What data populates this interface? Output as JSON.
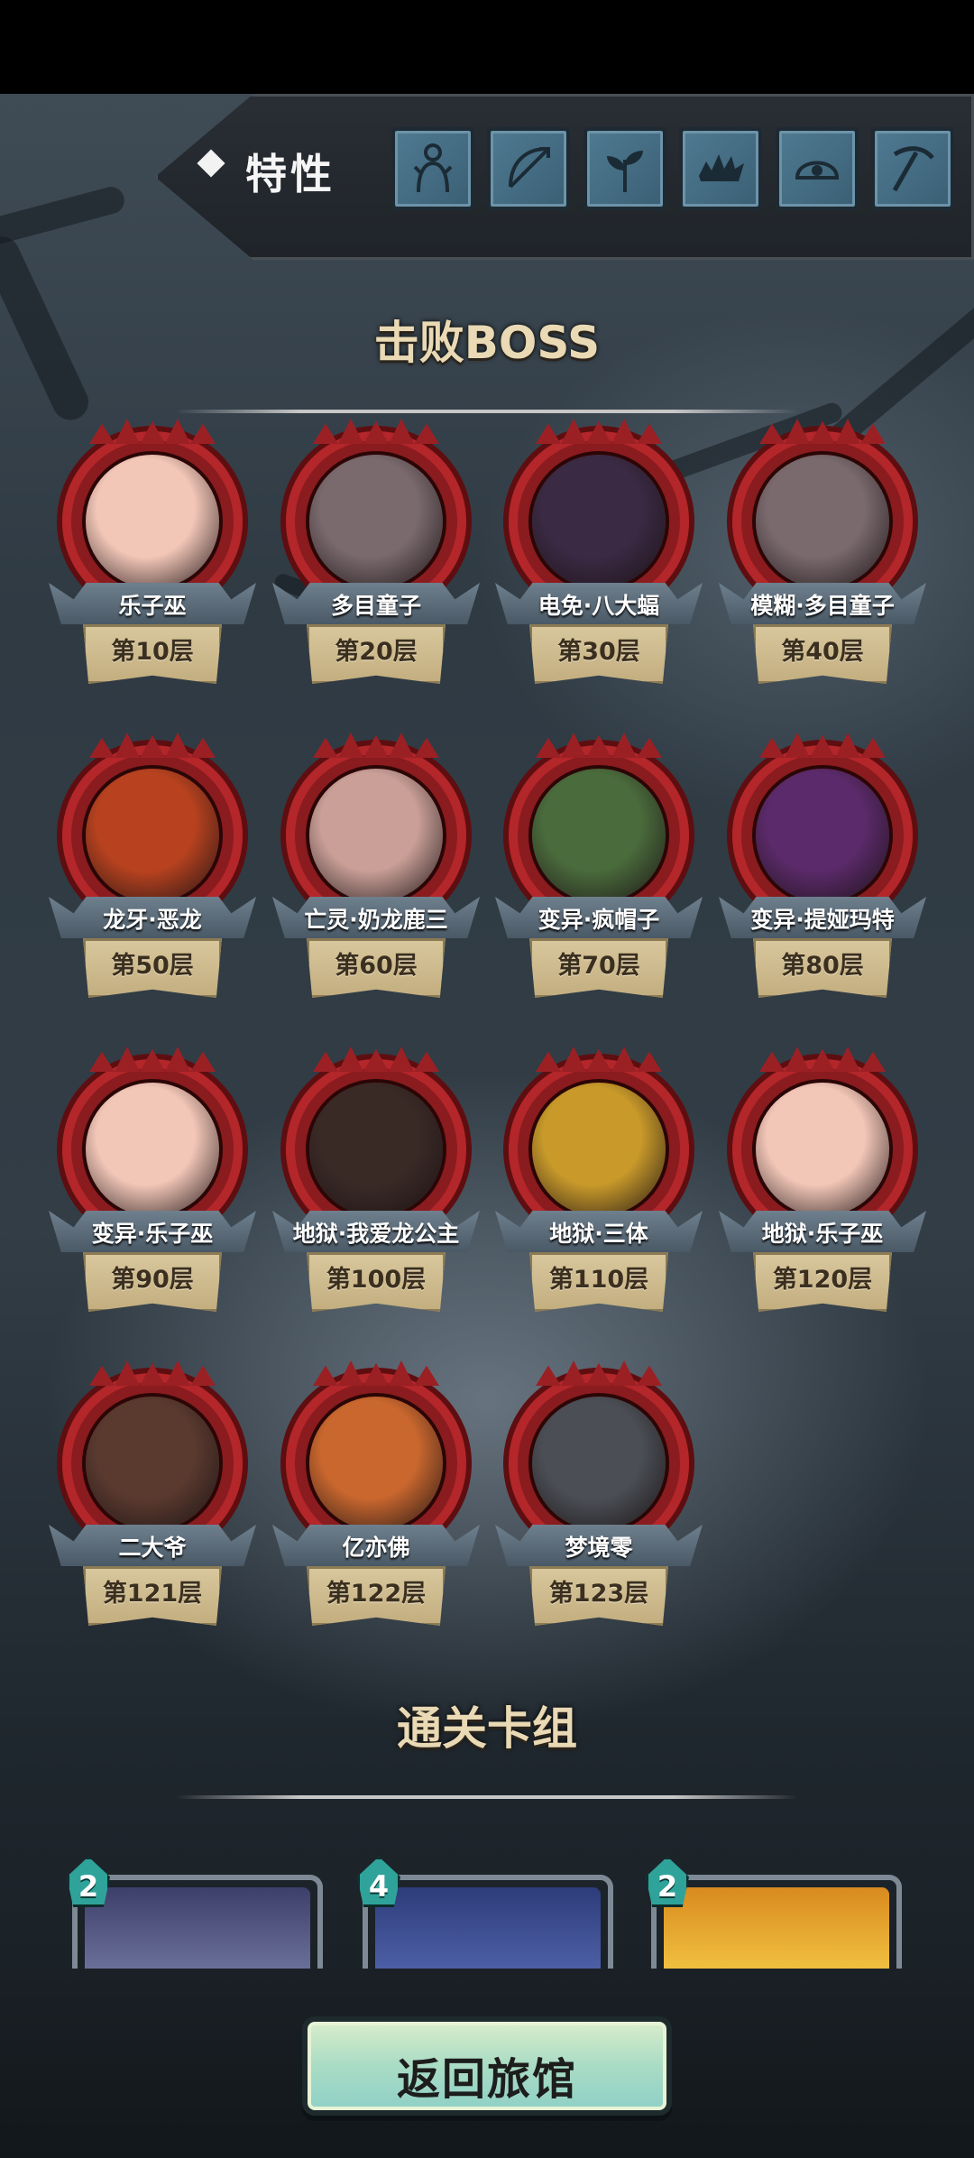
{
  "traits": {
    "label": "特性",
    "icons": [
      "strongman-icon",
      "bow-arrow-icon",
      "plant-icon",
      "spiky-creature-icon",
      "cloud-eye-icon",
      "pickaxe-icon"
    ]
  },
  "bosses_section": {
    "title": "击败BOSS",
    "items": [
      {
        "name": "乐子巫",
        "floor": "第10层",
        "color": "#f3c7b8"
      },
      {
        "name": "多目童子",
        "floor": "第20层",
        "color": "#7a6a6e"
      },
      {
        "name": "电免·八大蝠",
        "floor": "第30层",
        "color": "#3b2a44"
      },
      {
        "name": "模糊·多目童子",
        "floor": "第40层",
        "color": "#7a6a6e"
      },
      {
        "name": "龙牙·恶龙",
        "floor": "第50层",
        "color": "#b8421f"
      },
      {
        "name": "亡灵·奶龙鹿三",
        "floor": "第60层",
        "color": "#c99f97"
      },
      {
        "name": "变异·疯帽子",
        "floor": "第70层",
        "color": "#4a6b3c"
      },
      {
        "name": "变异·提娅玛特",
        "floor": "第80层",
        "color": "#5b2a6a"
      },
      {
        "name": "变异·乐子巫",
        "floor": "第90层",
        "color": "#f3c7b8"
      },
      {
        "name": "地狱·我爱龙公主",
        "floor": "第100层",
        "color": "#3a2a26"
      },
      {
        "name": "地狱·三体",
        "floor": "第110层",
        "color": "#c99a2a"
      },
      {
        "name": "地狱·乐子巫",
        "floor": "第120层",
        "color": "#f3c7b8"
      },
      {
        "name": "二大爷",
        "floor": "第121层",
        "color": "#5a3a2f"
      },
      {
        "name": "亿亦佛",
        "floor": "第122层",
        "color": "#c9672e"
      },
      {
        "name": "梦境零",
        "floor": "第123层",
        "color": "#4b4f55"
      }
    ]
  },
  "deck_section": {
    "title": "通关卡组",
    "cards": [
      {
        "cost": "2",
        "art_color": "#3c3f6a"
      },
      {
        "cost": "4",
        "art_color": "#2d3c7a"
      },
      {
        "cost": "2",
        "art_color": "#d98a1e"
      }
    ]
  },
  "return_button": "返回旅馆"
}
